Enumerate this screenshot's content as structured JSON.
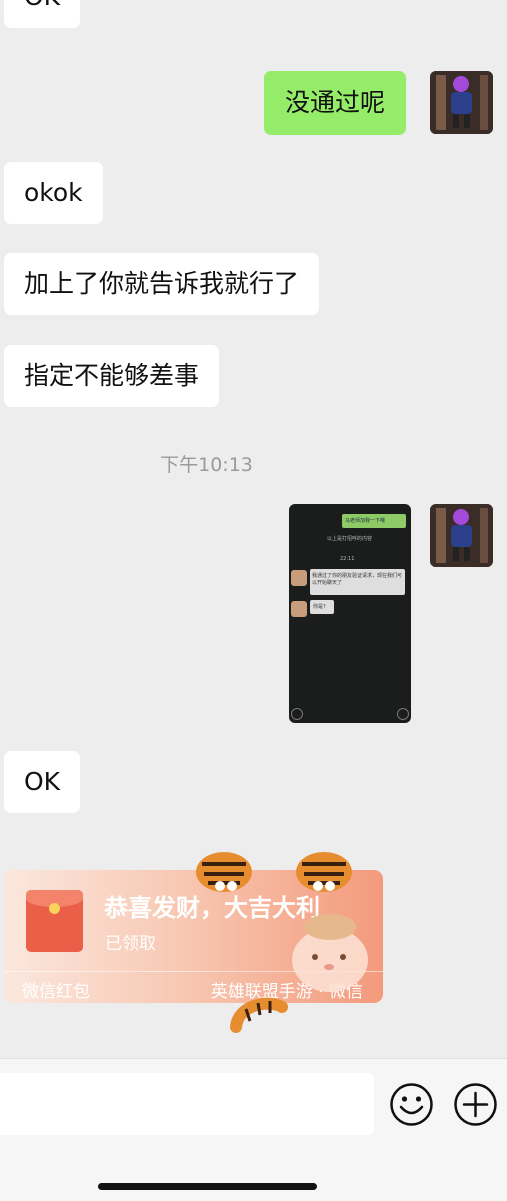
{
  "messages": [
    {
      "text": "OK"
    },
    {
      "text": "没通过呢"
    },
    {
      "text": "okok"
    },
    {
      "text": "加上了你就告诉我就行了"
    },
    {
      "text": "指定不能够差事"
    },
    {
      "text": "OK"
    }
  ],
  "timestamp": "下午10:13",
  "screenshot_image": {
    "green_bubble": "马老师加我一下哦",
    "system_text": "以上是打招呼的内容",
    "time": "22:11",
    "reply_1": "我通过了你的朋友验证请求，现在我们可以开始聊天了",
    "reply_2": "你是?"
  },
  "red_packet": {
    "title": "恭喜发财，大吉大利",
    "status": "已领取",
    "label": "微信红包",
    "source": "英雄联盟手游 · 微信"
  },
  "input_bar": {
    "emoji_icon": "smiley-face-icon",
    "plus_icon": "plus-circle-icon"
  },
  "colors": {
    "background": "#ededed",
    "sent_bubble": "#95ec69",
    "received_bubble": "#ffffff",
    "red_packet": "#f39a7c"
  }
}
